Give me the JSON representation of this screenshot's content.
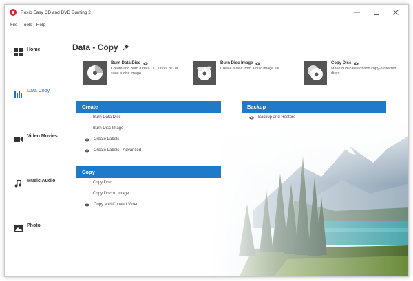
{
  "window": {
    "title": "Roxio Easy CD and DVD Burning 2",
    "menu": [
      "File",
      "Tools",
      "Help"
    ]
  },
  "sidebar": {
    "items": [
      {
        "label": "Home",
        "icon": "home-icon"
      },
      {
        "label": "Data Copy",
        "icon": "data-copy-icon",
        "active": true
      },
      {
        "label": "Video Movies",
        "icon": "video-icon"
      },
      {
        "label": "Music Audio",
        "icon": "music-icon"
      },
      {
        "label": "Photo",
        "icon": "photo-icon"
      }
    ]
  },
  "main": {
    "title": "Data - Copy",
    "features": [
      {
        "title": "Burn Data Disc",
        "desc": "Create and burn a data CD, DVD, BD or save a disc image",
        "icon": "disc-icon"
      },
      {
        "title": "Burn Disc Image",
        "desc": "Create a disc from a disc image file",
        "icon": "disc-image-icon"
      },
      {
        "title": "Copy Disc",
        "desc": "Make duplicates of non copy-protected discs",
        "icon": "copy-disc-icon"
      }
    ],
    "sections": {
      "create": {
        "title": "Create",
        "links": [
          "Burn Data Disc",
          "Burn Disc Image",
          "Create Labels",
          "Create Labels - Advanced"
        ]
      },
      "copy": {
        "title": "Copy",
        "links": [
          "Copy Disc",
          "Copy Disc to Image",
          "Copy and Convert Video"
        ]
      },
      "backup": {
        "title": "Backup",
        "links": [
          "Backup and Restore"
        ]
      }
    }
  },
  "colors": {
    "accent": "#1f7ac9",
    "active_nav": "#1a74c2",
    "brand": "#d02a2a"
  }
}
